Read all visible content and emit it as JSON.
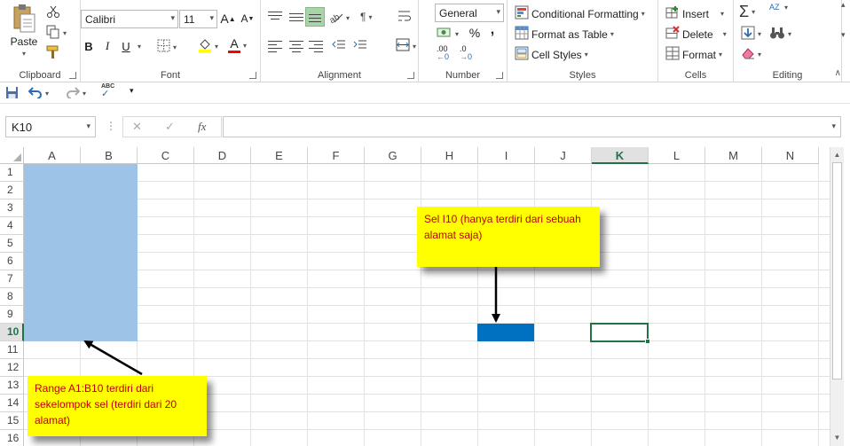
{
  "ribbon": {
    "clipboard": {
      "label": "Clipboard",
      "paste_label": "Paste"
    },
    "font": {
      "label": "Font",
      "font_name": "Calibri",
      "font_size": "11",
      "bold": "B",
      "italic": "I",
      "underline": "U",
      "grow": "A",
      "shrink": "A",
      "font_color_letter": "A",
      "font_color": "#ff0000",
      "fill_color": "#ffff00"
    },
    "alignment": {
      "label": "Alignment"
    },
    "number": {
      "label": "Number",
      "format": "General",
      "percent": "%",
      "comma": ",",
      "inc_decimal": ".00",
      "dec_decimal": ".0"
    },
    "styles": {
      "label": "Styles",
      "conditional_formatting": "Conditional Formatting",
      "format_as_table": "Format as Table",
      "cell_styles": "Cell Styles"
    },
    "cells": {
      "label": "Cells",
      "insert": "Insert",
      "delete": "Delete",
      "format": "Format"
    },
    "editing": {
      "label": "Editing",
      "sum": "Σ",
      "sort": "AZ"
    }
  },
  "qat": {
    "spelling": "ABC"
  },
  "formula_bar": {
    "name_box": "K10",
    "cancel": "✕",
    "enter": "✓",
    "fx": "fx",
    "value": ""
  },
  "sheet": {
    "columns": [
      "A",
      "B",
      "C",
      "D",
      "E",
      "F",
      "G",
      "H",
      "I",
      "J",
      "K",
      "L",
      "M",
      "N"
    ],
    "selected_column": "K",
    "rows": [
      "1",
      "2",
      "3",
      "4",
      "5",
      "6",
      "7",
      "8",
      "9",
      "10",
      "11",
      "12",
      "13",
      "14",
      "15",
      "16"
    ],
    "selected_row": "10",
    "colors": {
      "range_fill": "#9dc3e6",
      "cell_fill": "#0070c0",
      "active_border": "#217346",
      "callout_bg": "#ffff00",
      "callout_text": "#c00000"
    }
  },
  "annotations": {
    "cell_i10": "Sel I10 (hanya terdiri dari sebuah alamat saja)",
    "range_a1_b10": "Range A1:B10 terdiri dari sekelompok sel (terdiri dari 20 alamat)"
  }
}
